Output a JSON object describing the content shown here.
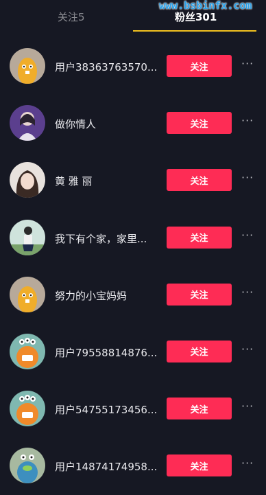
{
  "tabs": {
    "following": "关注5",
    "fans": "粉丝301"
  },
  "watermark": "www.bsbinfx.com",
  "follow_label": "关注",
  "more_label": "···",
  "users": [
    {
      "name": "用户38363763570...",
      "avatar": "cartoon-beige"
    },
    {
      "name": "做你情人",
      "avatar": "photo-purple"
    },
    {
      "name": "黄 雅 丽",
      "avatar": "photo-light"
    },
    {
      "name": "我下有个家，家里...",
      "avatar": "photo-outdoor"
    },
    {
      "name": "努力的小宝妈妈",
      "avatar": "cartoon-beige"
    },
    {
      "name": "用户79558814876...",
      "avatar": "cartoon-monster-orange"
    },
    {
      "name": "用户54755173456...",
      "avatar": "cartoon-monster-orange"
    },
    {
      "name": "用户14874174958...",
      "avatar": "cartoon-monster-blue"
    }
  ],
  "colors": {
    "background": "#161823",
    "follow_button": "#fe2c55",
    "tab_underline": "#f2c21f"
  }
}
